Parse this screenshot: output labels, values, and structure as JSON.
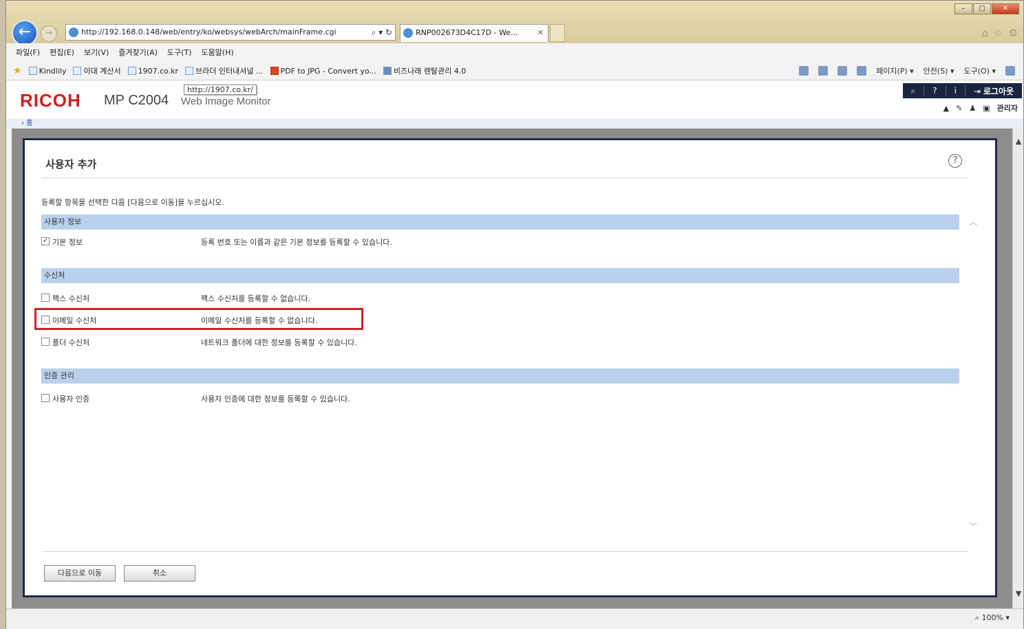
{
  "browser": {
    "url": "http://192.168.0.148/web/entry/ko/websys/webArch/mainFrame.cgi",
    "tab_title": "RNP002673D4C17D - We...",
    "menu": [
      "파일(F)",
      "편집(E)",
      "보기(V)",
      "즐겨찾기(A)",
      "도구(T)",
      "도움말(H)"
    ],
    "favorites": [
      "Kindlily",
      "이대 계산서",
      "1907.co.kr",
      "브라더 인터내셔널 ...",
      "PDF to JPG - Convert yo...",
      "비즈나래 렌탈관리 4.0"
    ],
    "commands": [
      "페이지(P) ▾",
      "안전(S) ▾",
      "도구(O) ▾"
    ],
    "zoom": "100%"
  },
  "header": {
    "brand": "RICOH",
    "model": "MP C2004",
    "subtitle": "Web Image Monitor",
    "tooltip": "http://1907.co.kr/",
    "logout": "로그아웃",
    "admin": "관리자",
    "home": "홈"
  },
  "dialog": {
    "title": "사용자 추가",
    "instruction": "등록할 항목을 선택한 다음 [다음으로 이동]을 누르십시오.",
    "sections": [
      {
        "title": "사용자 정보",
        "items": [
          {
            "label": "기본 정보",
            "description": "등록 번호 또는 이름과 같은 기본 정보를 등록할 수 있습니다.",
            "checked": true
          }
        ]
      },
      {
        "title": "수신처",
        "items": [
          {
            "label": "팩스 수신처",
            "description": "팩스 수신처를 등록할 수 없습니다.",
            "checked": false
          },
          {
            "label": "이메일 수신처",
            "description": "이메일 수신처를 등록할 수 없습니다.",
            "checked": false
          },
          {
            "label": "폴더 수신처",
            "description": "네트워크 폴더에 대한 정보를 등록할 수 있습니다.",
            "checked": false
          }
        ]
      },
      {
        "title": "인증 관리",
        "items": [
          {
            "label": "사용자 인증",
            "description": "사용자 인증에 대한 정보를 등록할 수 있습니다.",
            "checked": false
          }
        ]
      }
    ],
    "next_button": "다음으로 이동",
    "cancel_button": "취소"
  },
  "colors": {
    "ricoh_red": "#d21e1e",
    "section_blue": "#b9d1ec",
    "highlight_red": "#d3202b",
    "dialog_border": "#1f2a48"
  }
}
